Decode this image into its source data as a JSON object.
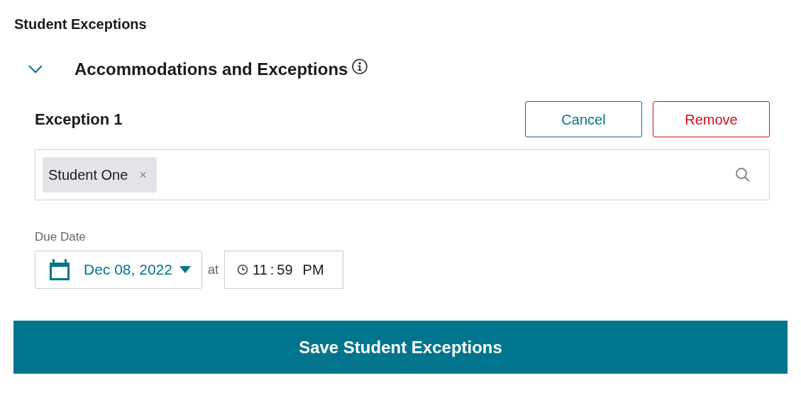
{
  "page_title": "Student Exceptions",
  "section": {
    "title": "Accommodations and Exceptions",
    "expanded": true
  },
  "exception": {
    "title": "Exception 1",
    "buttons": [
      {
        "label": "Cancel",
        "kind": "secondary"
      },
      {
        "label": "Remove",
        "kind": "danger"
      }
    ],
    "chips": [
      {
        "label": "Student One",
        "remove": "×"
      }
    ],
    "due_date": {
      "label": "Due Date",
      "date": "Dec 08, 2022",
      "at": "at",
      "hour": "11",
      "separator": ":",
      "minute": "59",
      "period": "PM"
    }
  },
  "save_button": "Save Student Exceptions"
}
